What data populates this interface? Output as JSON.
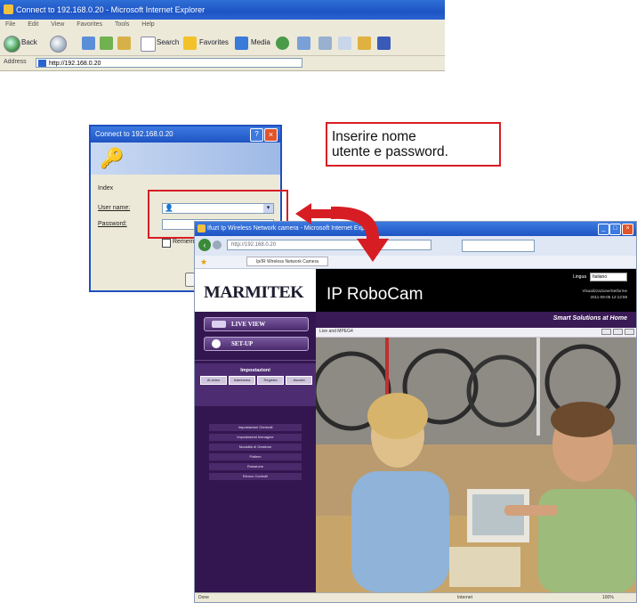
{
  "background_browser": {
    "title": "Connect to 192.168.0.20 - Microsoft Internet Explorer",
    "menu": [
      "File",
      "Edit",
      "View",
      "Favorites",
      "Tools",
      "Help"
    ],
    "toolbar": {
      "back": "Back",
      "search": "Search",
      "favorites": "Favorites",
      "media": "Media"
    },
    "address_label": "Address",
    "address_value": "http://192.168.0.20"
  },
  "login_dialog": {
    "title": "Connect to 192.168.0.20",
    "help_symbol": "?",
    "close_symbol": "×",
    "prompt_label": "Index",
    "username_label": "User name:",
    "password_label": "Password:",
    "remember_label": "Remember my password"
  },
  "callout": {
    "text_line1": "Inserire nome",
    "text_line2": "utente e password."
  },
  "foreground_browser": {
    "title": "Ifuzt Ip Wireless Network camera - Microsoft Internet Explorer",
    "url": "http://192.168.0.20",
    "favorites_tab": "Ip/IR Wireless Network Camera",
    "status_left": "Done",
    "status_middle": "Internet",
    "status_right": "100%"
  },
  "camera_page": {
    "logo": "MARMITEK",
    "title": "IP RoboCam",
    "language_label": "Lingua",
    "language_value": "Italiano",
    "status_line1": "Visualizzazione/Setforme",
    "status_line2": "2011-09-05 12:13:59",
    "tagline": "Smart Solutions at Home",
    "video_caption": "Live and MPEG4",
    "sidebar": {
      "live_view": "LIVE VIEW",
      "setup": "SET-UP",
      "camera_heading": "Impostazioni",
      "camera_buttons": [
        "Al video",
        "Istantanea",
        "Registra",
        "Ascolta"
      ],
      "menu": [
        "Impostazioni Generali",
        "Impostazioni Immagine",
        "Modalità di Gestione",
        "Pattern",
        "Rotazione",
        "Elenco Controlli"
      ]
    }
  },
  "colors": {
    "highlight_red": "#d71d24",
    "xp_blue": "#1e54c4",
    "purple_dark": "#33164f",
    "purple_band": "#3a1a55"
  }
}
